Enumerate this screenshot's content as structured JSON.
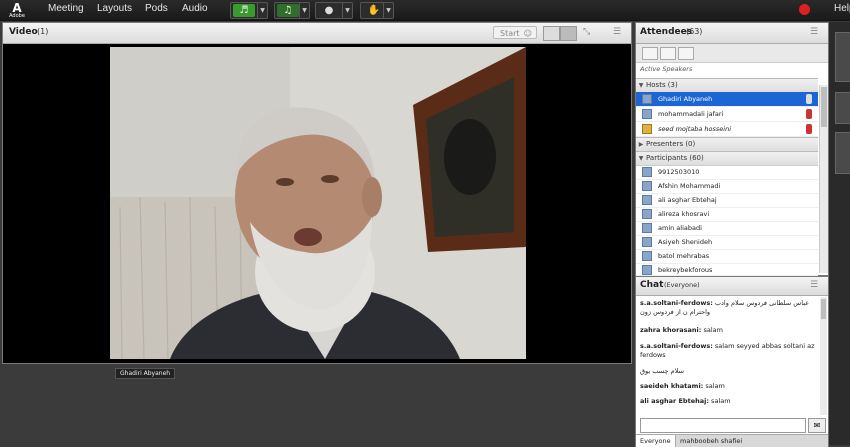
{
  "topbar": {
    "logo_text": "A",
    "logo_sub": "Adobe",
    "menu": [
      "Meeting",
      "Layouts",
      "Pods",
      "Audio"
    ],
    "help": "Help"
  },
  "video_pod": {
    "title": "Video",
    "count": "(1)",
    "start_label": "Start",
    "speaker_name": "Ghadiri Abyaneh"
  },
  "attendees_pod": {
    "title": "Attendees",
    "count": "(63)",
    "active_speakers": "Active Speakers",
    "hosts_label": "Hosts (3)",
    "hosts": [
      "Ghadiri Abyaneh",
      "mohammadali jafari",
      "seed mojtaba hosseini"
    ],
    "presenters_label": "Presenters (0)",
    "participants_label": "Participants (60)",
    "participants": [
      "9912503010",
      "Afshin Mohammadi",
      "ali asghar Ebtehaj",
      "alireza khosravi",
      "amin aliabadi",
      "Asiyeh Shenideh",
      "batol mehrabas",
      "bekreybekforous"
    ]
  },
  "chat_pod": {
    "title": "Chat",
    "scope": "(Everyone)",
    "messages": [
      {
        "sender": "s.a.soltani-ferdows:",
        "text": "عباس سلطانی فردوس سلام وادب واحترام ن از فردوس زون"
      },
      {
        "sender": "zahra khorasani:",
        "text": "salam"
      },
      {
        "sender": "s.a.soltani-ferdows:",
        "text": "salam seyyed abbas soltani az ferdows"
      },
      {
        "sender": "",
        "text": "سلام چسب یوق"
      },
      {
        "sender": "saeideh khatami:",
        "text": "salam"
      },
      {
        "sender": "ali asghar Ebtehaj:",
        "text": "salam"
      }
    ],
    "tabs": [
      "Everyone",
      "mahboobeh shafiei"
    ]
  },
  "colors": {
    "selected_row": "#1b66d4",
    "recording": "#e02020",
    "audio_green": "#3a9a2e"
  },
  "icons": [
    "adobe-logo-icon",
    "speaker-icon",
    "microphone-icon",
    "webcam-icon",
    "raise-hand-icon",
    "record-icon",
    "pod-menu-icon",
    "user-icon",
    "send-icon"
  ]
}
